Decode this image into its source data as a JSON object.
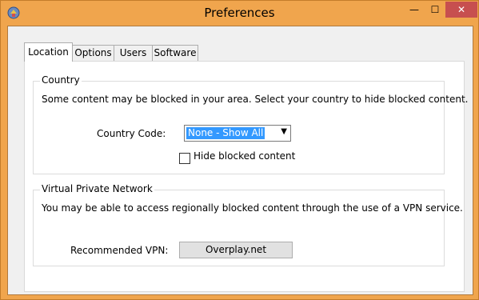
{
  "window": {
    "title": "Preferences",
    "app_icon": "prefs-app-icon",
    "controls": {
      "minimize": "—",
      "maximize": "☐",
      "close": "✕"
    }
  },
  "tabs": [
    {
      "label": "Location",
      "active": true
    },
    {
      "label": "Options",
      "active": false
    },
    {
      "label": "Users",
      "active": false
    },
    {
      "label": "Software",
      "active": false
    }
  ],
  "country": {
    "group_label": "Country",
    "description": "Some content may be blocked in your area.  Select your country to hide blocked content.",
    "code_label": "Country Code:",
    "code_value": "None - Show All",
    "hide_label": "Hide blocked content",
    "hide_checked": false
  },
  "vpn": {
    "group_label": "Virtual Private Network",
    "description": "You may be able to access regionally blocked content through the use of a VPN service.",
    "recommended_label": "Recommended VPN:",
    "recommended_button": "Overplay.net"
  },
  "colors": {
    "frame": "#f0a54d",
    "close": "#c74f4f",
    "selection": "#3399ff"
  }
}
